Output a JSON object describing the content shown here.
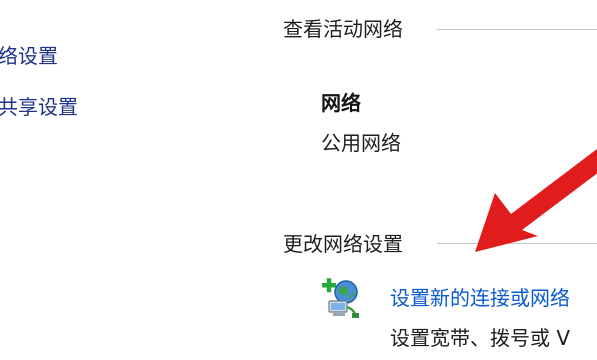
{
  "sidebar": {
    "items": [
      {
        "label": "络设置"
      },
      {
        "label": "共享设置"
      }
    ]
  },
  "active_networks": {
    "header": "查看活动网络",
    "network": {
      "name": "网络",
      "type": "公用网络"
    }
  },
  "change_settings": {
    "header": "更改网络设置",
    "task": {
      "icon": "new-connection-network-icon",
      "link": "设置新的连接或网络",
      "description": "设置宽带、拨号或 V"
    }
  },
  "annotation": {
    "arrow_color": "#e01c1c"
  }
}
